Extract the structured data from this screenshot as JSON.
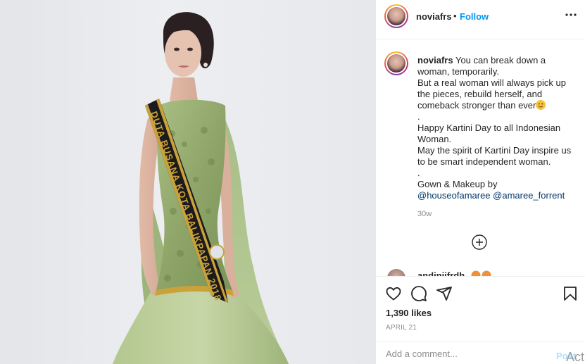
{
  "header": {
    "username": "noviafrs",
    "separator": "•",
    "follow_label": "Follow",
    "more_icon": "more-horizontal-icon"
  },
  "photo": {
    "sash_text": "DUTA BUSANA KOTA BALIKPAPAN 2018"
  },
  "caption": {
    "username": "noviafrs",
    "lines": [
      "You can break down a woman, temporarily.",
      "But a real woman will always pick up the pieces, rebuild herself, and comeback stronger than ever",
      ".",
      "Happy Kartini Day to all Indonesian Woman.",
      "May the spirit of Kartini Day inspire us to be smart independent woman.",
      ".",
      "Gown & Makeup by"
    ],
    "mentions": "@houseofamaree @amaree_forrent",
    "time": "30w"
  },
  "next_comment": {
    "username": "andinijfrdh"
  },
  "actions": {
    "like_icon": "heart-icon",
    "comment_icon": "comment-icon",
    "share_icon": "share-icon",
    "save_icon": "bookmark-icon",
    "likes": "1,390 likes",
    "date": "APRIL 21"
  },
  "comment_box": {
    "placeholder": "Add a comment...",
    "post_label": "Post",
    "watermark": "Act"
  },
  "colors": {
    "accent": "#0095f6",
    "link": "#00376b",
    "muted": "#8e8e8e",
    "gown": "#8fa86a",
    "sash": "#1c1a1d",
    "gold": "#c9a23a"
  }
}
